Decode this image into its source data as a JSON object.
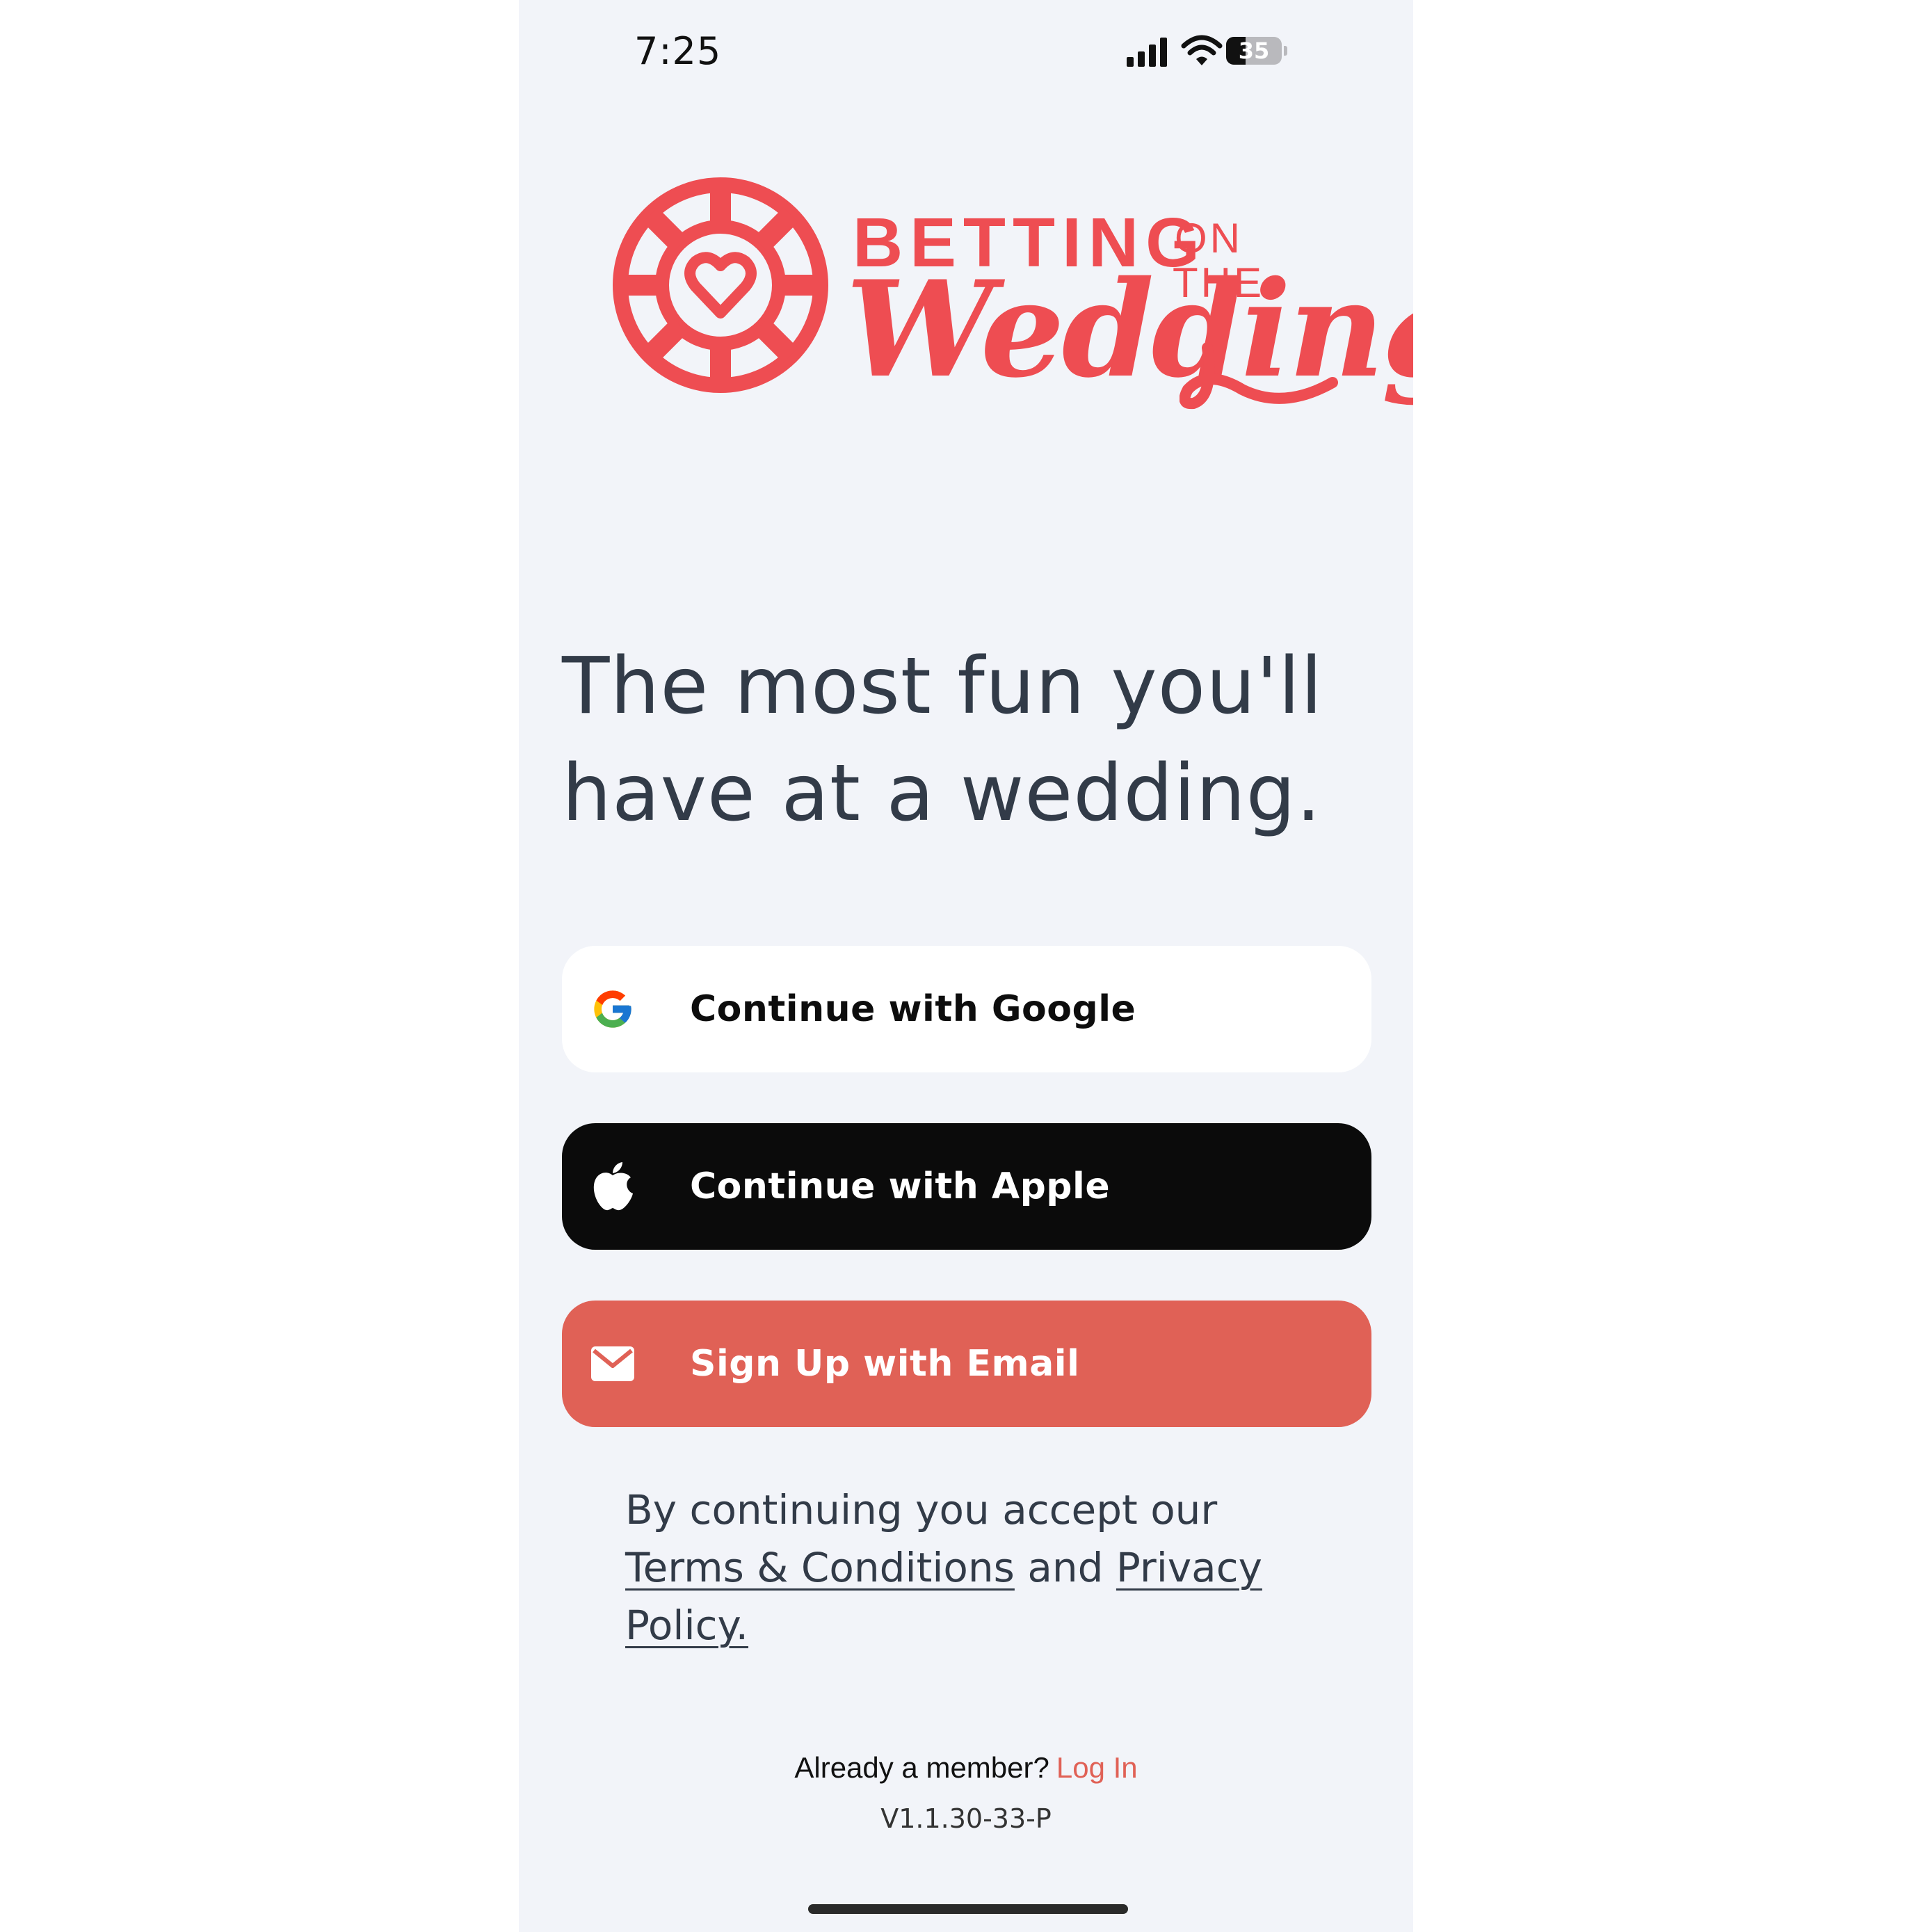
{
  "status_bar": {
    "time": "7:25",
    "battery": "35",
    "battery_level": 0.35
  },
  "logo": {
    "line1": "BETTING",
    "line_on": "ON",
    "line_the": "THE",
    "script": "Wedding",
    "colors": {
      "brand": "#ee4d52"
    }
  },
  "tagline": "The most fun you'll have at a wedding.",
  "buttons": {
    "google": {
      "label": "Continue with Google",
      "icon": "google-icon"
    },
    "apple": {
      "label": "Continue with Apple",
      "icon": "apple-icon"
    },
    "email": {
      "label": "Sign Up with Email",
      "icon": "mail-icon"
    }
  },
  "legal": {
    "prefix": "By continuing you accept our",
    "terms": "Terms & Conditions",
    "and": "and",
    "privacy": "Privacy Policy."
  },
  "footer": {
    "prompt": "Already a member?",
    "login": "Log In",
    "version": "V1.1.30-33-P"
  },
  "colors": {
    "background": "#f2f4f9",
    "text": "#323b48",
    "accent": "#e06156",
    "apple_bg": "#0b0b0b"
  }
}
